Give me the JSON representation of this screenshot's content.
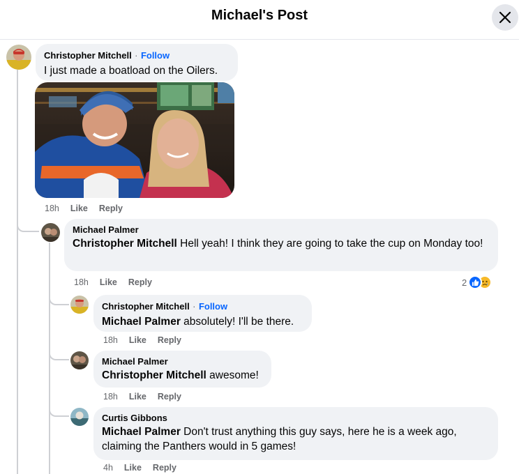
{
  "header": {
    "title": "Michael's Post"
  },
  "comments": [
    {
      "author": "Christopher Mitchell",
      "separator": "·",
      "follow": "Follow",
      "text": "I just made a boatload on the Oilers.",
      "time": "18h",
      "like": "Like",
      "reply": "Reply"
    },
    {
      "author": "Michael Palmer",
      "mention": "Christopher Mitchell",
      "text": " Hell yeah! I think they are going to take the cup on Monday too!",
      "time": "18h",
      "like": "Like",
      "reply": "Reply",
      "reaction_count": "2"
    },
    {
      "author": "Christopher Mitchell",
      "separator": "·",
      "follow": "Follow",
      "mention": "Michael Palmer",
      "text": " absolutely! I'll be there.",
      "time": "18h",
      "like": "Like",
      "reply": "Reply"
    },
    {
      "author": "Michael Palmer",
      "mention": "Christopher Mitchell",
      "text": " awesome!",
      "time": "18h",
      "like": "Like",
      "reply": "Reply"
    },
    {
      "author": "Curtis Gibbons",
      "mention": "Michael Palmer",
      "text": " Don't trust anything this guy says, here he is a week ago, claiming the Panthers would in 5 games!",
      "time": "4h",
      "like": "Like",
      "reply": "Reply"
    }
  ],
  "icons": {
    "close": "close-icon",
    "like": "like-reaction-icon",
    "sad": "sad-reaction-icon"
  },
  "colors": {
    "accent": "#0866ff",
    "bubble": "#f0f2f5",
    "muted": "#65676b"
  }
}
